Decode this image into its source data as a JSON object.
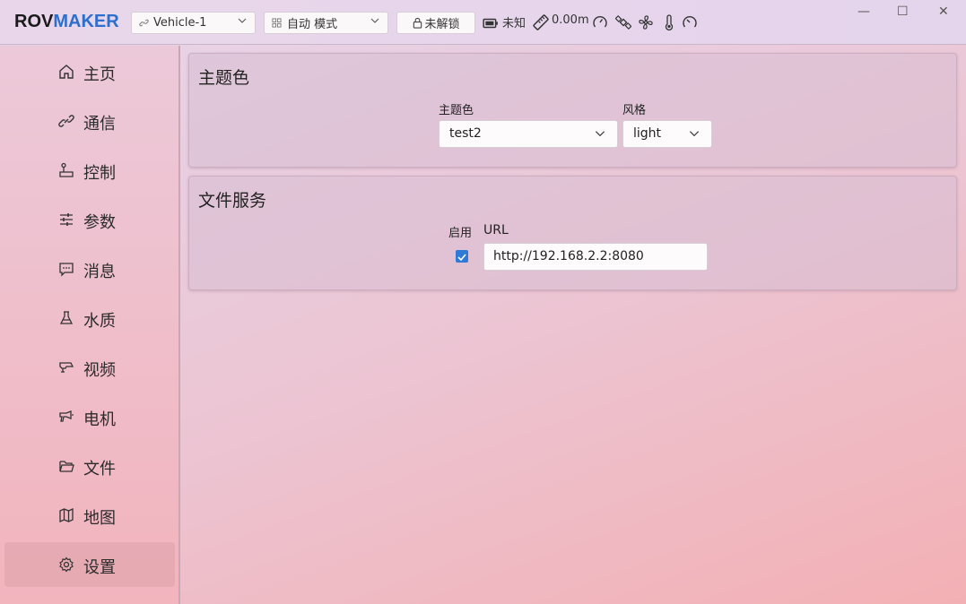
{
  "app": {
    "logo_part1": "ROV",
    "logo_part2": "MAKER",
    "brand_color": "#2d6fcc"
  },
  "toolbar": {
    "vehicle_select": "Vehicle-1",
    "mode_select": "自动 模式",
    "unlock_button": "未解锁",
    "battery_text": "未知",
    "depth_text": "0.00m",
    "icons": [
      "link-icon",
      "grid-icon",
      "lock-icon",
      "battery-icon",
      "ruler-icon",
      "gauge-icon",
      "satellite-icon",
      "fan-icon",
      "thermometer-icon",
      "speedometer-icon"
    ]
  },
  "window_controls": {
    "minimize": "—",
    "maximize": "☐",
    "close": "✕"
  },
  "sidebar": {
    "items": [
      {
        "label": "主页",
        "icon": "home-icon"
      },
      {
        "label": "通信",
        "icon": "link-icon"
      },
      {
        "label": "控制",
        "icon": "joystick-icon"
      },
      {
        "label": "参数",
        "icon": "sliders-icon"
      },
      {
        "label": "消息",
        "icon": "message-icon"
      },
      {
        "label": "水质",
        "icon": "flask-icon"
      },
      {
        "label": "视频",
        "icon": "camera-icon"
      },
      {
        "label": "电机",
        "icon": "motor-icon"
      },
      {
        "label": "文件",
        "icon": "folder-icon"
      },
      {
        "label": "地图",
        "icon": "map-icon"
      },
      {
        "label": "设置",
        "icon": "gear-icon"
      }
    ],
    "active_index": 10
  },
  "theme_section": {
    "title": "主题色",
    "theme_label": "主题色",
    "theme_value": "test2",
    "style_label": "风格",
    "style_value": "light"
  },
  "file_service_section": {
    "title": "文件服务",
    "enable_label": "启用",
    "enabled": true,
    "url_label": "URL",
    "url_value": "http://192.168.2.2:8080"
  }
}
